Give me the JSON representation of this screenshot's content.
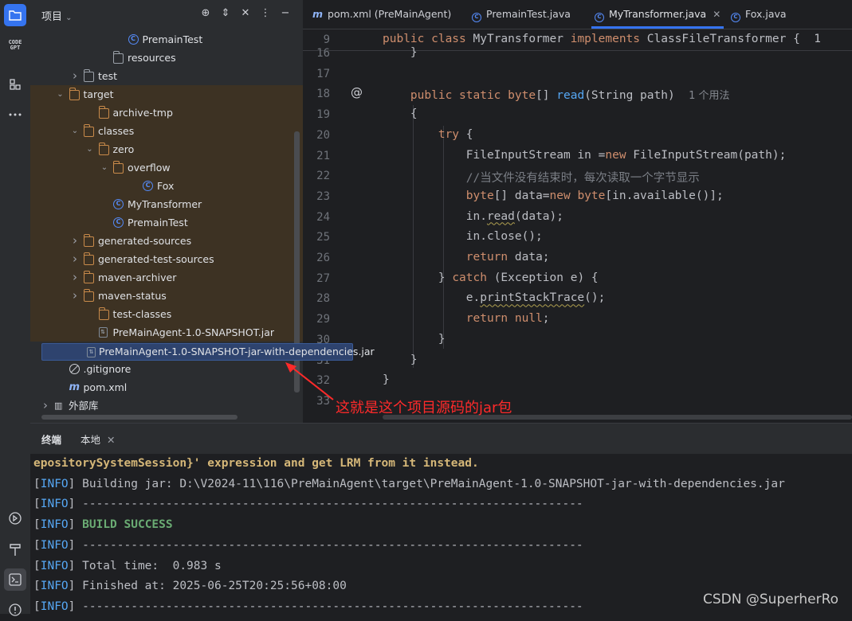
{
  "activity_bar": {
    "items": [
      "project-icon",
      "codegpt-icon",
      "structure-icon",
      "more-icon"
    ],
    "codegpt_label": "CODE GPT",
    "bottom_items": [
      "services-icon",
      "build-icon",
      "terminal-icon",
      "problems-icon"
    ]
  },
  "project": {
    "title": "项目",
    "header_icons": [
      "locate-icon",
      "expand-icon",
      "collapse-icon",
      "options-icon",
      "hide-icon"
    ],
    "tree": [
      {
        "label": "PremainTest",
        "icon": "class",
        "depth": 5,
        "expanded": null
      },
      {
        "label": "resources",
        "icon": "folder",
        "depth": 4,
        "expanded": null
      },
      {
        "label": "test",
        "icon": "folder",
        "depth": 2,
        "expanded": false
      },
      {
        "label": "target",
        "icon": "folder-orange",
        "depth": 1,
        "expanded": true
      },
      {
        "label": "archive-tmp",
        "icon": "folder-orange",
        "depth": 3,
        "expanded": null
      },
      {
        "label": "classes",
        "icon": "folder-orange",
        "depth": 2,
        "expanded": true
      },
      {
        "label": "zero",
        "icon": "folder-orange",
        "depth": 3,
        "expanded": true
      },
      {
        "label": "overflow",
        "icon": "folder-orange",
        "depth": 4,
        "expanded": true
      },
      {
        "label": "Fox",
        "icon": "class",
        "depth": 6,
        "expanded": null
      },
      {
        "label": "MyTransformer",
        "icon": "class",
        "depth": 4,
        "expanded": null
      },
      {
        "label": "PremainTest",
        "icon": "class",
        "depth": 4,
        "expanded": null
      },
      {
        "label": "generated-sources",
        "icon": "folder-orange",
        "depth": 2,
        "expanded": false
      },
      {
        "label": "generated-test-sources",
        "icon": "folder-orange",
        "depth": 2,
        "expanded": false
      },
      {
        "label": "maven-archiver",
        "icon": "folder-orange",
        "depth": 2,
        "expanded": false
      },
      {
        "label": "maven-status",
        "icon": "folder-orange",
        "depth": 2,
        "expanded": false
      },
      {
        "label": "test-classes",
        "icon": "folder-orange",
        "depth": 3,
        "expanded": null
      },
      {
        "label": "PreMainAgent-1.0-SNAPSHOT.jar",
        "icon": "jar",
        "depth": 3,
        "expanded": null
      },
      {
        "label": "PreMainAgent-1.0-SNAPSHOT-jar-with-dependencies.jar",
        "icon": "jar",
        "depth": 3,
        "expanded": null,
        "selected": true
      },
      {
        "label": ".gitignore",
        "icon": "ignore",
        "depth": 1,
        "expanded": null
      },
      {
        "label": "pom.xml",
        "icon": "maven",
        "depth": 1,
        "expanded": null
      },
      {
        "label": "外部库",
        "icon": "library",
        "depth": 0,
        "expanded": false
      }
    ]
  },
  "editor": {
    "tabs": [
      {
        "label": "pom.xml (PreMainAgent)",
        "icon": "maven",
        "active": false
      },
      {
        "label": "PremainTest.java",
        "icon": "class",
        "active": false
      },
      {
        "label": "MyTransformer.java",
        "icon": "class",
        "active": true,
        "closable": true
      },
      {
        "label": "Fox.java",
        "icon": "class",
        "active": false
      }
    ],
    "sticky_line": "9",
    "sticky_code": [
      {
        "t": "public class ",
        "c": "kw"
      },
      {
        "t": "MyTransformer ",
        "c": ""
      },
      {
        "t": "implements ",
        "c": "kw"
      },
      {
        "t": "ClassFileTransformer {  1",
        "c": ""
      }
    ],
    "lines": [
      {
        "n": "16",
        "segs": [
          {
            "t": "    }",
            "c": ""
          }
        ]
      },
      {
        "n": "17",
        "segs": []
      },
      {
        "n": "18",
        "segs": [
          {
            "t": "    public static byte",
            "c": "kw"
          },
          {
            "t": "[] ",
            "c": ""
          },
          {
            "t": "read",
            "c": "fn"
          },
          {
            "t": "(String path)  ",
            "c": ""
          },
          {
            "t": "1 个用法",
            "c": "hint"
          }
        ]
      },
      {
        "n": "19",
        "segs": [
          {
            "t": "    {",
            "c": ""
          }
        ]
      },
      {
        "n": "20",
        "segs": [
          {
            "t": "        try",
            "c": "kw"
          },
          {
            "t": " {",
            "c": ""
          }
        ]
      },
      {
        "n": "21",
        "segs": [
          {
            "t": "            FileInputStream in =",
            "c": ""
          },
          {
            "t": "new ",
            "c": "kw"
          },
          {
            "t": "FileInputStream(path);",
            "c": ""
          }
        ]
      },
      {
        "n": "22",
        "segs": [
          {
            "t": "            //当文件没有结束时，每次读取一个字节显示",
            "c": "cm"
          }
        ]
      },
      {
        "n": "23",
        "segs": [
          {
            "t": "            byte",
            "c": "kw"
          },
          {
            "t": "[] data=",
            "c": ""
          },
          {
            "t": "new byte",
            "c": "kw"
          },
          {
            "t": "[in.available()];",
            "c": ""
          }
        ]
      },
      {
        "n": "24",
        "segs": [
          {
            "t": "            in.",
            "c": ""
          },
          {
            "t": "read",
            "c": "wavy"
          },
          {
            "t": "(data);",
            "c": ""
          }
        ]
      },
      {
        "n": "25",
        "segs": [
          {
            "t": "            in.close();",
            "c": ""
          }
        ]
      },
      {
        "n": "26",
        "segs": [
          {
            "t": "            return ",
            "c": "kw"
          },
          {
            "t": "data;",
            "c": ""
          }
        ]
      },
      {
        "n": "27",
        "segs": [
          {
            "t": "        } ",
            "c": ""
          },
          {
            "t": "catch ",
            "c": "kw"
          },
          {
            "t": "(Exception e) {",
            "c": ""
          }
        ]
      },
      {
        "n": "28",
        "segs": [
          {
            "t": "            e.",
            "c": ""
          },
          {
            "t": "printStackTrace",
            "c": "wavy"
          },
          {
            "t": "();",
            "c": ""
          }
        ]
      },
      {
        "n": "29",
        "segs": [
          {
            "t": "            return null",
            "c": "kw"
          },
          {
            "t": ";",
            "c": ""
          }
        ]
      },
      {
        "n": "30",
        "segs": [
          {
            "t": "        }",
            "c": ""
          }
        ]
      },
      {
        "n": "31",
        "segs": [
          {
            "t": "    }",
            "c": ""
          }
        ]
      },
      {
        "n": "32",
        "segs": [
          {
            "t": "}",
            "c": ""
          }
        ]
      },
      {
        "n": "33",
        "segs": []
      }
    ]
  },
  "annotation": {
    "text": "这就是这个项目源码的jar包",
    "color": "#ff2a2a"
  },
  "terminal": {
    "tab_title": "终端",
    "tab_local": "本地",
    "lines": [
      [
        {
          "t": "epositorySystemSession}' expression and get LRM from it instead.",
          "c": "warn-y"
        }
      ],
      [
        {
          "t": "[",
          "c": ""
        },
        {
          "t": "INFO",
          "c": "info"
        },
        {
          "t": "] Building jar: D:\\V2024-11\\116\\PreMainAgent\\target\\PreMainAgent-1.0-SNAPSHOT-jar-with-dependencies.jar",
          "c": ""
        }
      ],
      [
        {
          "t": "[",
          "c": ""
        },
        {
          "t": "INFO",
          "c": "info"
        },
        {
          "t": "] ------------------------------------------------------------------------",
          "c": ""
        }
      ],
      [
        {
          "t": "[",
          "c": ""
        },
        {
          "t": "INFO",
          "c": "info"
        },
        {
          "t": "] ",
          "c": ""
        },
        {
          "t": "BUILD SUCCESS",
          "c": "succ"
        }
      ],
      [
        {
          "t": "[",
          "c": ""
        },
        {
          "t": "INFO",
          "c": "info"
        },
        {
          "t": "] ------------------------------------------------------------------------",
          "c": ""
        }
      ],
      [
        {
          "t": "[",
          "c": ""
        },
        {
          "t": "INFO",
          "c": "info"
        },
        {
          "t": "] Total time:  0.983 s",
          "c": ""
        }
      ],
      [
        {
          "t": "[",
          "c": ""
        },
        {
          "t": "INFO",
          "c": "info"
        },
        {
          "t": "] Finished at: 2025-06-25T20:25:56+08:00",
          "c": ""
        }
      ],
      [
        {
          "t": "[",
          "c": ""
        },
        {
          "t": "INFO",
          "c": "info"
        },
        {
          "t": "] ------------------------------------------------------------------------",
          "c": ""
        }
      ]
    ]
  },
  "watermark": "CSDN @SuperherRo",
  "colors": {
    "accent": "#3574f0",
    "keyword": "#cf8e6d",
    "function": "#56a8f5",
    "success": "#6aab73",
    "annotation": "#ff2a2a"
  }
}
